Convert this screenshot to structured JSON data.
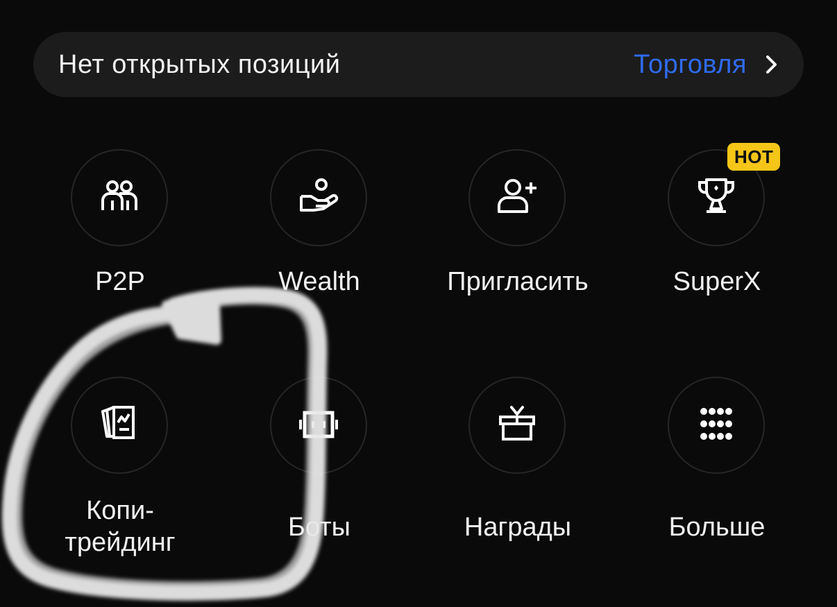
{
  "positions": {
    "empty_text": "Нет открытых позиций",
    "trade_label": "Торговля"
  },
  "menu": {
    "items": [
      {
        "label": "P2P",
        "icon": "users-icon"
      },
      {
        "label": "Wealth",
        "icon": "hand-coin-icon"
      },
      {
        "label": "Пригласить",
        "icon": "add-user-icon"
      },
      {
        "label": "SuperX",
        "icon": "trophy-icon",
        "badge": "HOT"
      },
      {
        "label": "Копи-\nтрейдинг",
        "icon": "copy-trading-icon"
      },
      {
        "label": "Боты",
        "icon": "bot-icon"
      },
      {
        "label": "Награды",
        "icon": "gift-icon"
      },
      {
        "label": "Больше",
        "icon": "grid-dots-icon"
      }
    ]
  },
  "colors": {
    "background": "#0a0a0a",
    "bar_background": "#1c1c1c",
    "accent_link": "#2f6bf2",
    "badge": "#f5c518"
  }
}
